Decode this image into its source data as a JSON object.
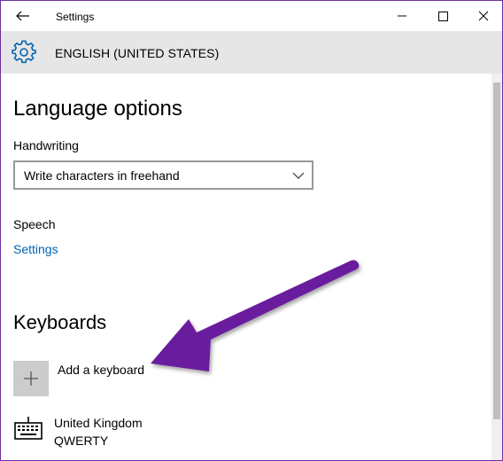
{
  "window": {
    "title": "Settings",
    "controls": [
      "minimize-icon",
      "maximize-icon",
      "close-icon"
    ]
  },
  "header": {
    "title": "ENGLISH (UNITED STATES)",
    "icon": "gear-icon"
  },
  "content": {
    "heading": "Language options",
    "handwriting": {
      "label": "Handwriting",
      "selected": "Write characters in freehand"
    },
    "speech": {
      "label": "Speech",
      "link": "Settings"
    },
    "keyboards": {
      "heading": "Keyboards",
      "add_label": "Add a keyboard",
      "items": [
        {
          "name": "United Kingdom",
          "layout": "QWERTY",
          "icon": "keyboard-icon"
        }
      ]
    }
  },
  "colors": {
    "accent": "#0063b1",
    "header_bg": "#e6e6e6",
    "annotation_arrow": "#6b1f9e"
  }
}
